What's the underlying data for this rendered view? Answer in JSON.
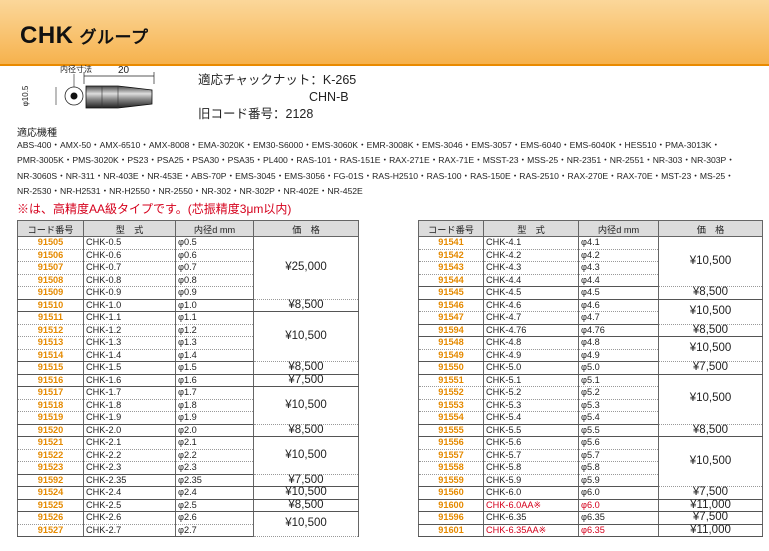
{
  "header": {
    "series": "CHK",
    "group": "グループ"
  },
  "diagram": {
    "dim_label": "内径寸法",
    "length": "20",
    "diameter": "φ10.5"
  },
  "spec": {
    "line1": "適応チャックナット：K-265",
    "line2": "CHN-B",
    "line3": "旧コード番号：2128"
  },
  "machines_label": "適応機種",
  "machines": [
    "ABS-400・AMX-50・AMX-6510・AMX-8008・EMA-3020K・EM30-S6000・EMS-3060K・EMR-3008K・EMS-3046・EMS-3057・EMS-6040・EMS-6040K・HES510・PMA-3013K・",
    "PMR-3005K・PMS-3020K・PS23・PSA25・PSA30・PSA35・PL400・RAS-101・RAS-151E・RAX-271E・RAX-71E・MSST-23・MSS-25・NR-2351・NR-2551・NR-303・NR-303P・",
    "NR-3060S・NR-311・NR-403E・NR-453E・ABS-70P・EMS-3045・EMS-3056・FG-01S・RAS-H2510・RAS-100・RAS-150E・RAS-2510・RAX-270E・RAX-70E・MST-23・MS-25・",
    "NR-2530・NR-H2531・NR-H2550・NR-2550・NR-302・NR-302P・NR-402E・NR-452E"
  ],
  "note": "※は、高精度AA級タイプです。(芯振精度3μm以内)",
  "table_headers": {
    "code": "コード番号",
    "model": "型　式",
    "diameter": "内径d mm",
    "price": "価　格"
  },
  "left_table": [
    {
      "code": "91505",
      "model": "CHK-0.5",
      "dia": "φ0.5",
      "price": "¥25,000",
      "span": 5
    },
    {
      "code": "91506",
      "model": "CHK-0.6",
      "dia": "φ0.6"
    },
    {
      "code": "91507",
      "model": "CHK-0.7",
      "dia": "φ0.7"
    },
    {
      "code": "91508",
      "model": "CHK-0.8",
      "dia": "φ0.8"
    },
    {
      "code": "91509",
      "model": "CHK-0.9",
      "dia": "φ0.9"
    },
    {
      "code": "91510",
      "model": "CHK-1.0",
      "dia": "φ1.0",
      "price": "¥8,500",
      "span": 1
    },
    {
      "code": "91511",
      "model": "CHK-1.1",
      "dia": "φ1.1",
      "price": "¥10,500",
      "span": 4
    },
    {
      "code": "91512",
      "model": "CHK-1.2",
      "dia": "φ1.2"
    },
    {
      "code": "91513",
      "model": "CHK-1.3",
      "dia": "φ1.3"
    },
    {
      "code": "91514",
      "model": "CHK-1.4",
      "dia": "φ1.4"
    },
    {
      "code": "91515",
      "model": "CHK-1.5",
      "dia": "φ1.5",
      "price": "¥8,500",
      "span": 1
    },
    {
      "code": "91516",
      "model": "CHK-1.6",
      "dia": "φ1.6",
      "price": "¥7,500",
      "span": 1
    },
    {
      "code": "91517",
      "model": "CHK-1.7",
      "dia": "φ1.7",
      "price": "¥10,500",
      "span": 3
    },
    {
      "code": "91518",
      "model": "CHK-1.8",
      "dia": "φ1.8"
    },
    {
      "code": "91519",
      "model": "CHK-1.9",
      "dia": "φ1.9"
    },
    {
      "code": "91520",
      "model": "CHK-2.0",
      "dia": "φ2.0",
      "price": "¥8,500",
      "span": 1
    },
    {
      "code": "91521",
      "model": "CHK-2.1",
      "dia": "φ2.1",
      "price": "¥10,500",
      "span": 3
    },
    {
      "code": "91522",
      "model": "CHK-2.2",
      "dia": "φ2.2"
    },
    {
      "code": "91523",
      "model": "CHK-2.3",
      "dia": "φ2.3"
    },
    {
      "code": "91592",
      "model": "CHK-2.35",
      "dia": "φ2.35",
      "price": "¥7,500",
      "span": 1
    },
    {
      "code": "91524",
      "model": "CHK-2.4",
      "dia": "φ2.4",
      "price": "¥10,500",
      "span": 1
    },
    {
      "code": "91525",
      "model": "CHK-2.5",
      "dia": "φ2.5",
      "price": "¥8,500",
      "span": 1
    },
    {
      "code": "91526",
      "model": "CHK-2.6",
      "dia": "φ2.6",
      "price": "¥10,500",
      "span": 2
    },
    {
      "code": "91527",
      "model": "CHK-2.7",
      "dia": "φ2.7"
    }
  ],
  "right_table": [
    {
      "code": "91541",
      "model": "CHK-4.1",
      "dia": "φ4.1",
      "price": "¥10,500",
      "span": 4
    },
    {
      "code": "91542",
      "model": "CHK-4.2",
      "dia": "φ4.2"
    },
    {
      "code": "91543",
      "model": "CHK-4.3",
      "dia": "φ4.3"
    },
    {
      "code": "91544",
      "model": "CHK-4.4",
      "dia": "φ4.4"
    },
    {
      "code": "91545",
      "model": "CHK-4.5",
      "dia": "φ4.5",
      "price": "¥8,500",
      "span": 1
    },
    {
      "code": "91546",
      "model": "CHK-4.6",
      "dia": "φ4.6",
      "price": "¥10,500",
      "span": 2
    },
    {
      "code": "91547",
      "model": "CHK-4.7",
      "dia": "φ4.7"
    },
    {
      "code": "91594",
      "model": "CHK-4.76",
      "dia": "φ4.76",
      "price": "¥8,500",
      "span": 1
    },
    {
      "code": "91548",
      "model": "CHK-4.8",
      "dia": "φ4.8",
      "price": "¥10,500",
      "span": 2
    },
    {
      "code": "91549",
      "model": "CHK-4.9",
      "dia": "φ4.9"
    },
    {
      "code": "91550",
      "model": "CHK-5.0",
      "dia": "φ5.0",
      "price": "¥7,500",
      "span": 1
    },
    {
      "code": "91551",
      "model": "CHK-5.1",
      "dia": "φ5.1",
      "price": "¥10,500",
      "span": 4
    },
    {
      "code": "91552",
      "model": "CHK-5.2",
      "dia": "φ5.2"
    },
    {
      "code": "91553",
      "model": "CHK-5.3",
      "dia": "φ5.3"
    },
    {
      "code": "91554",
      "model": "CHK-5.4",
      "dia": "φ5.4"
    },
    {
      "code": "91555",
      "model": "CHK-5.5",
      "dia": "φ5.5",
      "price": "¥8,500",
      "span": 1
    },
    {
      "code": "91556",
      "model": "CHK-5.6",
      "dia": "φ5.6",
      "price": "¥10,500",
      "span": 4
    },
    {
      "code": "91557",
      "model": "CHK-5.7",
      "dia": "φ5.7"
    },
    {
      "code": "91558",
      "model": "CHK-5.8",
      "dia": "φ5.8"
    },
    {
      "code": "91559",
      "model": "CHK-5.9",
      "dia": "φ5.9"
    },
    {
      "code": "91560",
      "model": "CHK-6.0",
      "dia": "φ6.0",
      "price": "¥7,500",
      "span": 1
    },
    {
      "code": "91600",
      "model": "CHK-6.0AA※",
      "dia": "φ6.0",
      "price": "¥11,000",
      "span": 1,
      "red": true
    },
    {
      "code": "91596",
      "model": "CHK-6.35",
      "dia": "φ6.35",
      "price": "¥7,500",
      "span": 1
    },
    {
      "code": "91601",
      "model": "CHK-6.35AA※",
      "dia": "φ6.35",
      "price": "¥11,000",
      "span": 1,
      "red": true
    }
  ]
}
